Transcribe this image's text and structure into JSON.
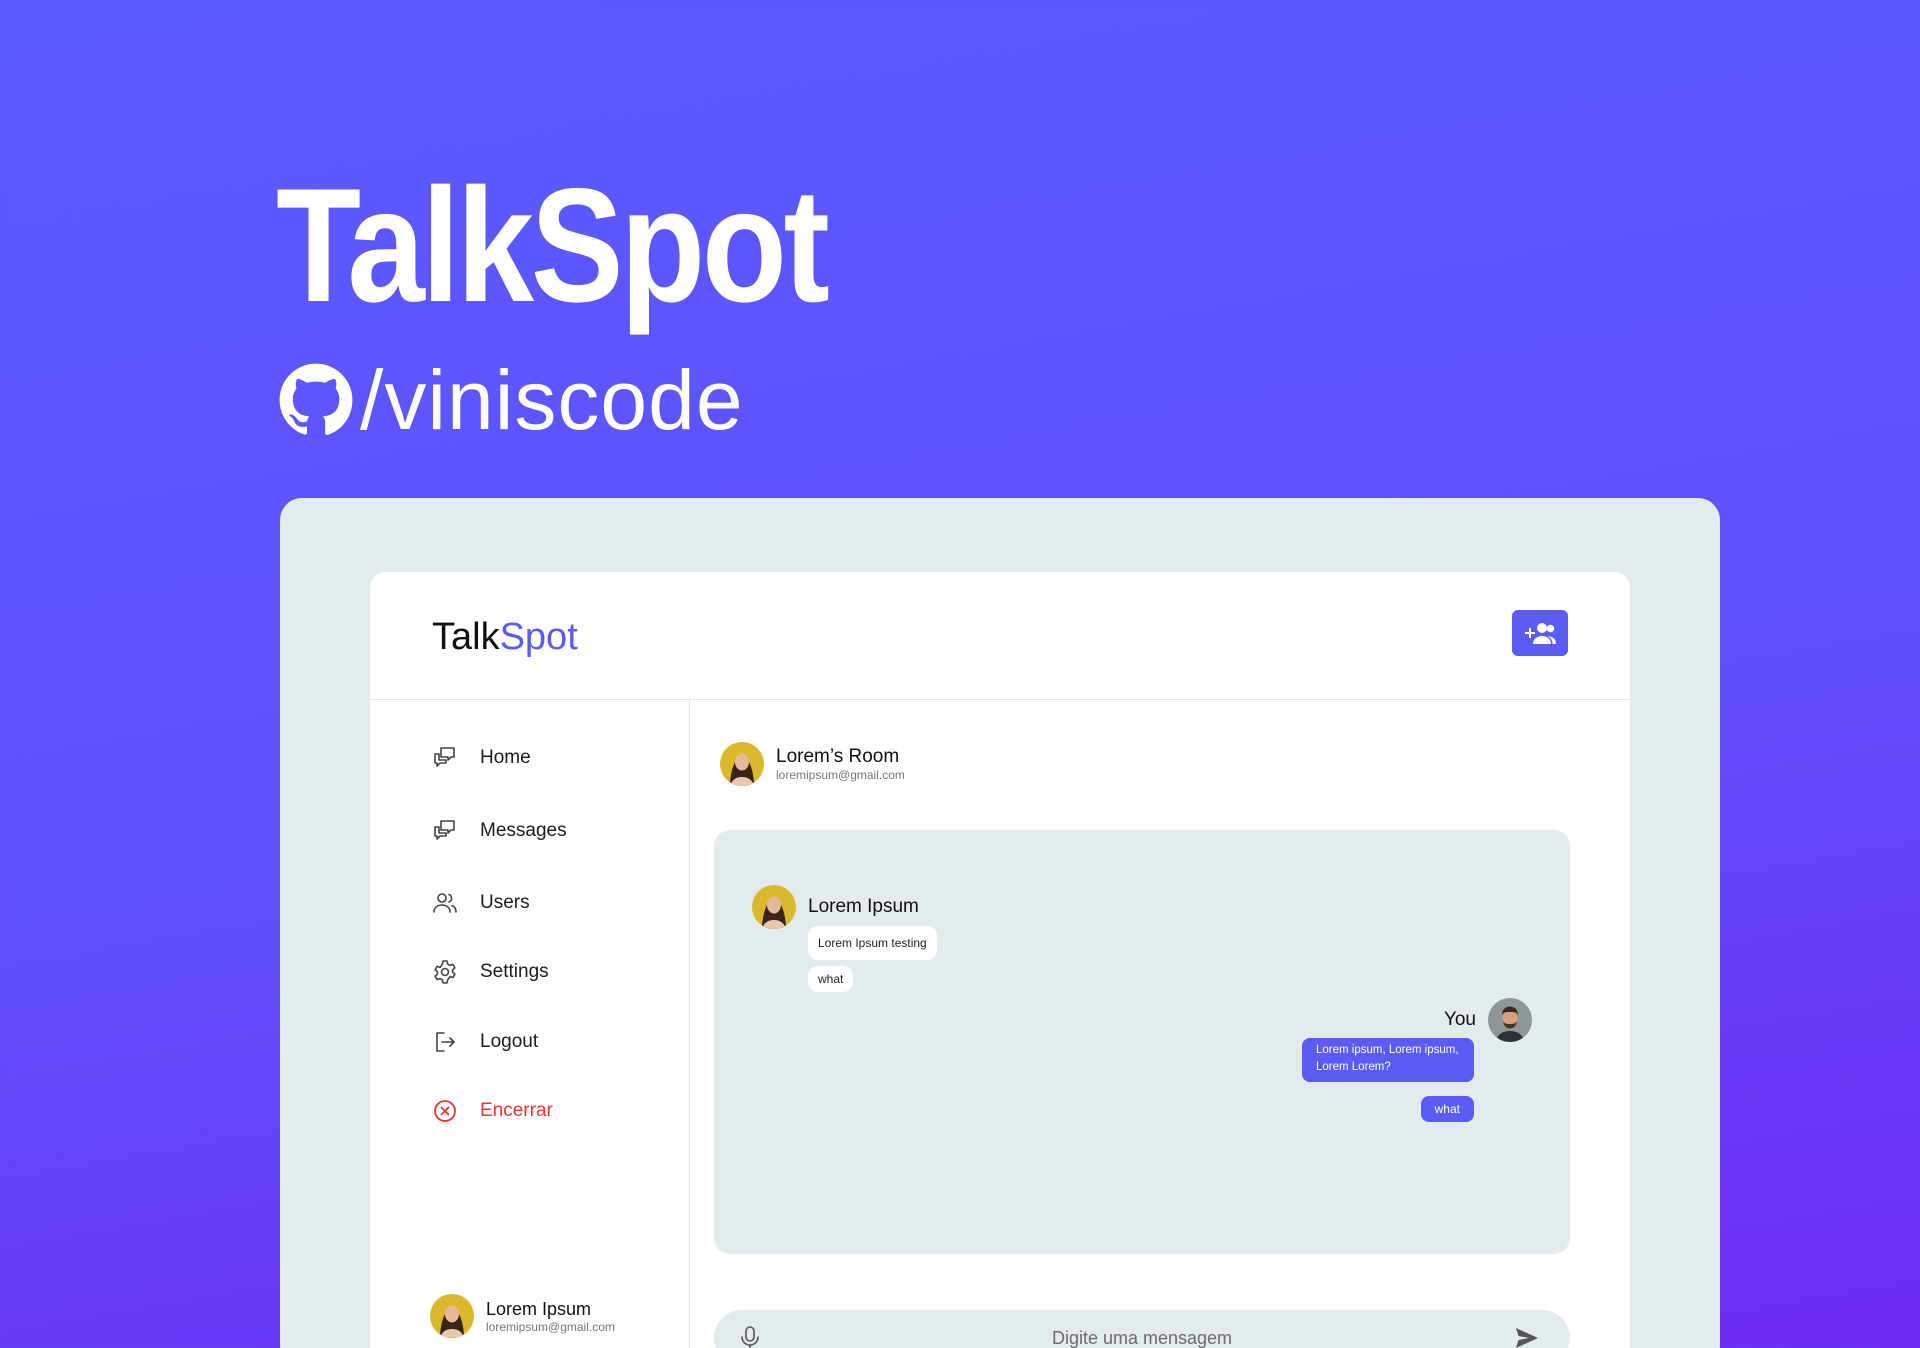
{
  "hero": {
    "title": "TalkSpot",
    "github_handle": "/viniscode",
    "github_icon": "github-icon"
  },
  "app": {
    "brand_part1": "Talk",
    "brand_part2": "Spot",
    "add_users_icon": "group-add-icon",
    "colors": {
      "accent": "#5b5cf6",
      "danger": "#f13232",
      "panel": "#e4ebef"
    }
  },
  "sidebar": {
    "items": [
      {
        "label": "Home",
        "icon": "chat-bubbles-icon"
      },
      {
        "label": "Messages",
        "icon": "chat-bubbles-icon"
      },
      {
        "label": "Users",
        "icon": "users-icon"
      },
      {
        "label": "Settings",
        "icon": "gear-icon"
      },
      {
        "label": "Logout",
        "icon": "logout-icon"
      },
      {
        "label": "Encerrar",
        "icon": "close-circle-icon"
      }
    ],
    "profile": {
      "name": "Lorem Ipsum",
      "email": "loremipsum@gmail.com"
    }
  },
  "room": {
    "title": "Lorem’s Room",
    "email": "loremipsum@gmail.com"
  },
  "chat": {
    "incoming": {
      "author": "Lorem Ipsum",
      "messages": [
        "Lorem Ipsum testing",
        "what"
      ]
    },
    "outgoing": {
      "author": "You",
      "messages": [
        "Lorem ipsum, Lorem ipsum, Lorem Lorem?",
        "what"
      ]
    }
  },
  "composer": {
    "placeholder": "Digite uma mensagem",
    "mic_icon": "microphone-icon",
    "send_icon": "send-icon"
  }
}
